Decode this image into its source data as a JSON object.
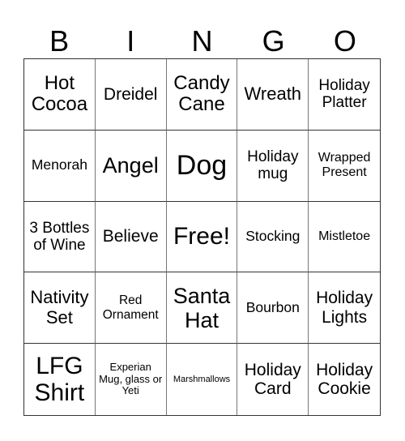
{
  "header": {
    "letters": [
      "B",
      "I",
      "N",
      "G",
      "O"
    ]
  },
  "cells": [
    [
      "Hot Cocoa",
      "Dreidel",
      "Candy Cane",
      "Wreath",
      "Holiday Platter"
    ],
    [
      "Menorah",
      "Angel",
      "Dog",
      "Holiday mug",
      "Wrapped Present"
    ],
    [
      "3 Bottles of Wine",
      "Believe",
      "Free!",
      "Stocking",
      "Mistletoe"
    ],
    [
      "Nativity Set",
      "Red Ornament",
      "Santa Hat",
      "Bourbon",
      "Holiday Lights"
    ],
    [
      "LFG Shirt",
      "Experian Mug, glass or Yeti",
      "Marshmallows",
      "Holiday Card",
      "Holiday Cookie"
    ]
  ],
  "free_space": "Free!"
}
